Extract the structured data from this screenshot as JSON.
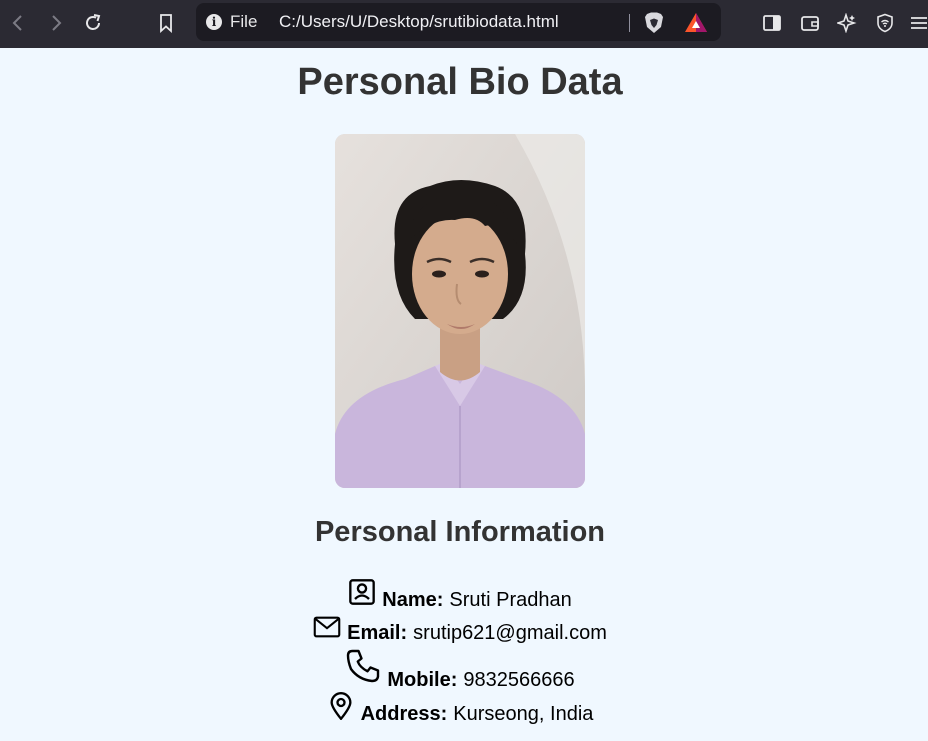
{
  "browser": {
    "url_scheme": "File",
    "url": "C:/Users/U/Desktop/srutibiodata.html",
    "info_icon": "i"
  },
  "page": {
    "title": "Personal Bio Data",
    "photo_icon": "profile-photo",
    "section_title": "Personal Information",
    "fields": [
      {
        "label": "Name:",
        "value": "Sruti Pradhan",
        "icon": "contact-card-icon"
      },
      {
        "label": "Email:",
        "value": "srutip621@gmail.com",
        "icon": "envelope-icon"
      },
      {
        "label": "Mobile:",
        "value": "9832566666",
        "icon": "phone-icon"
      },
      {
        "label": "Address:",
        "value": "Kurseong, India",
        "icon": "location-pin-icon"
      }
    ]
  },
  "colors": {
    "page_bg": "#f0f8ff",
    "heading": "#333333",
    "toolbar_bg": "#2b2a33",
    "urlbar_bg": "#1c1b22"
  }
}
